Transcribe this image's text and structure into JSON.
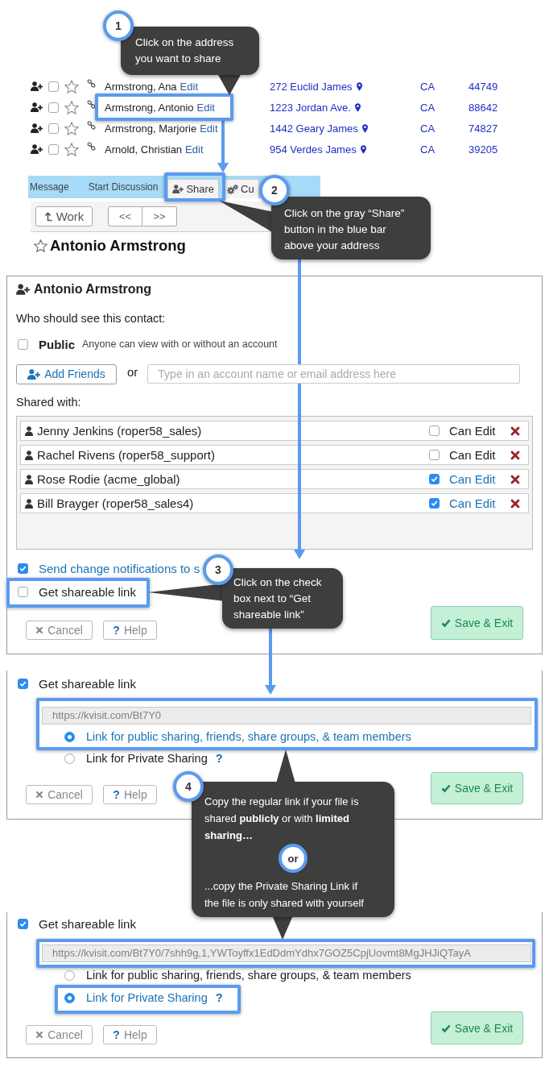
{
  "contacts": [
    {
      "name": "Armstrong, Ana",
      "edit": "Edit",
      "address": "272 Euclid James",
      "state": "CA",
      "zip": "44749",
      "checked": false,
      "starred": false
    },
    {
      "name": "Armstrong, Antonio",
      "edit": "Edit",
      "address": "1223 Jordan Ave.",
      "state": "CA",
      "zip": "88642",
      "checked": false,
      "starred": false
    },
    {
      "name": "Armstrong, Marjorie",
      "edit": "Edit",
      "address": "1442 Geary James",
      "state": "CA",
      "zip": "74827",
      "checked": false,
      "starred": false
    },
    {
      "name": "Arnold, Christian",
      "edit": "Edit",
      "address": "954 Verdes James",
      "state": "CA",
      "zip": "39205",
      "checked": false,
      "starred": false
    }
  ],
  "action_bar": [
    {
      "kind": "link",
      "label": "Message"
    },
    {
      "kind": "link",
      "label": "Start Discussion"
    },
    {
      "kind": "share",
      "label": "Share"
    },
    {
      "kind": "customize",
      "label": "Cu"
    }
  ],
  "toolbar": {
    "back": "Work",
    "previous": "<<",
    "next": ">>"
  },
  "contact_title": {
    "name": "Antonio Armstrong",
    "starred": false
  },
  "share_dialog": {
    "title": "Antonio Armstrong",
    "prompt": "Who should see this contact:",
    "public": {
      "label": "Public",
      "description": "Anyone can view with or without an account",
      "checked": false
    },
    "add_friends": "Add Friends",
    "or": "or",
    "account_field": {
      "placeholder": "Type in an account name or email address here"
    },
    "shared_label": "Shared with:",
    "shared_with": [
      {
        "name": "Jenny Jenkins (roper58_sales)",
        "permission": "Can Edit",
        "can_edit": false
      },
      {
        "name": "Rachel Rivens (roper58_support)",
        "permission": "Can Edit",
        "can_edit": false
      },
      {
        "name": "Rose Rodie (acme_global)",
        "permission": "Can Edit",
        "can_edit": true
      },
      {
        "name": "Bill Brayger (roper58_sales4)",
        "permission": "Can Edit",
        "can_edit": true
      }
    ],
    "notify": {
      "label": "Send change notifications to s",
      "checked": true
    },
    "shareable": {
      "label": "Get shareable link",
      "checked": false
    },
    "buttons": {
      "cancel": "Cancel",
      "help_glyph": "?",
      "help": "Help",
      "save": "Save & Exit"
    }
  },
  "link_panels": [
    {
      "shareable": {
        "label": "Get shareable link",
        "checked": true
      },
      "url": "https://kvisit.com/Bt7Y0",
      "options": [
        {
          "label": "Link for public sharing, friends, share groups, & team members",
          "selected": true
        },
        {
          "label": "Link for Private Sharing",
          "hint": "?",
          "selected": false
        }
      ],
      "buttons": {
        "cancel": "Cancel",
        "help_glyph": "?",
        "help": "Help",
        "save": "Save & Exit"
      }
    },
    {
      "shareable": {
        "label": "Get shareable link",
        "checked": true
      },
      "url": "https://kvisit.com/Bt7Y0/7shh9g,1,YWToyffx1EdDdmYdhx7GOZ5CpjUovmt8MgJHJiQTayA",
      "options": [
        {
          "label": "Link for public sharing, friends, share groups, & team members",
          "selected": false
        },
        {
          "label": "Link for Private Sharing",
          "hint": "?",
          "selected": true
        }
      ],
      "buttons": {
        "cancel": "Cancel",
        "help_glyph": "?",
        "help": "Help",
        "save": "Save & Exit"
      }
    }
  ],
  "steps": [
    {
      "number": "1",
      "text": "Click on the address you want to share"
    },
    {
      "number": "2",
      "text": "Click on the gray “Share” button in the blue bar above your address"
    },
    {
      "number": "3",
      "text": "Click on the check box next to “Get shareable link”"
    },
    {
      "number": "4",
      "text": "Copy the regular link if your file is shared **publicly** or with **limited sharing…**",
      "separator": "or",
      "text_2": "...copy the Private Sharing Link if the file is only shared with yourself"
    }
  ]
}
